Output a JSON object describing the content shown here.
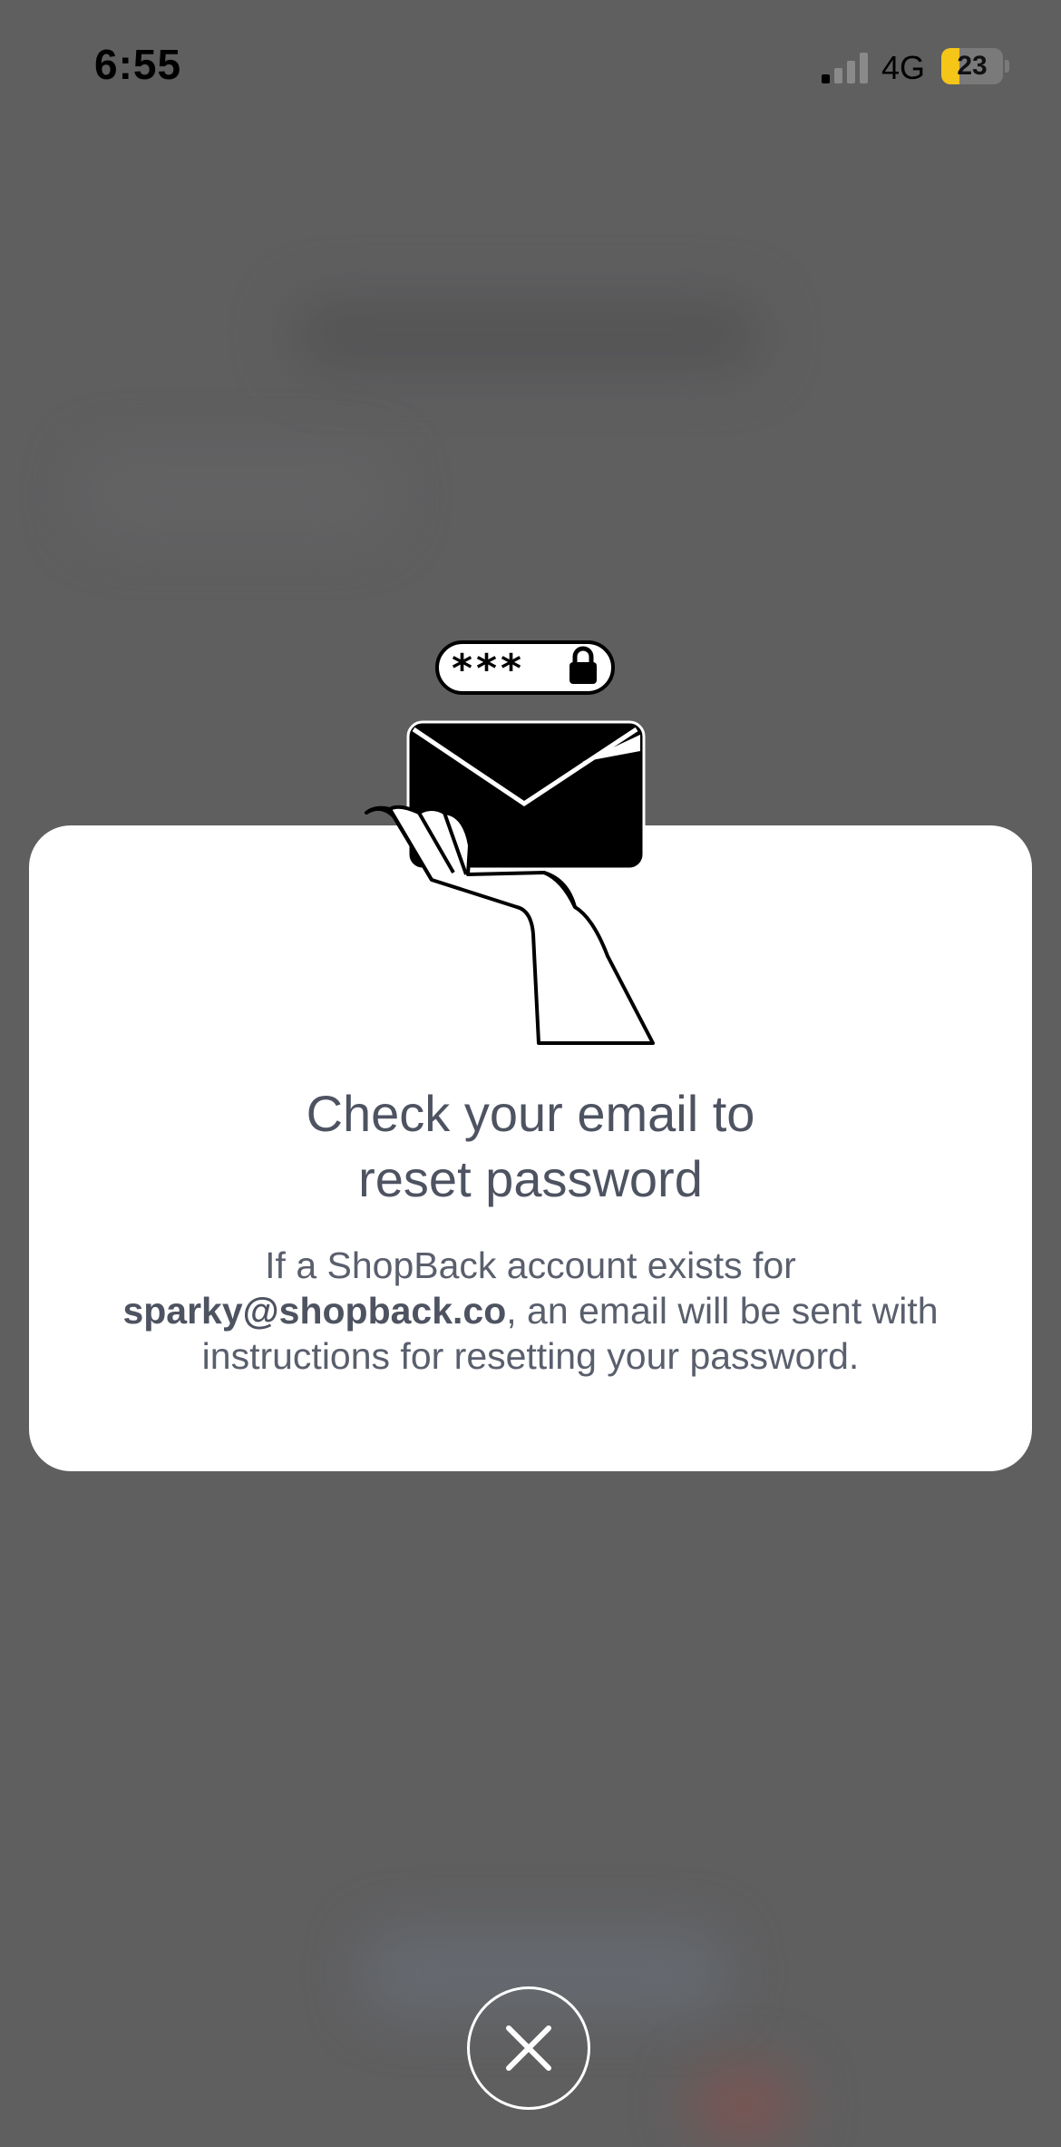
{
  "status_bar": {
    "time": "6:55",
    "network": "4G",
    "battery": "23"
  },
  "modal": {
    "password_mask": "***",
    "title_line1": "Check your email to",
    "title_line2": "reset password",
    "body_prefix": "If a ShopBack account exists for",
    "email": "sparky@shopback.co",
    "body_suffix": ", an email will be sent with instructions for resetting your password."
  },
  "close_button": {
    "icon": "close-icon"
  },
  "colors": {
    "overlay": "#5f5f60",
    "modal_bg": "#ffffff",
    "title": "#4e5361",
    "battery_low": "#f5c518"
  }
}
